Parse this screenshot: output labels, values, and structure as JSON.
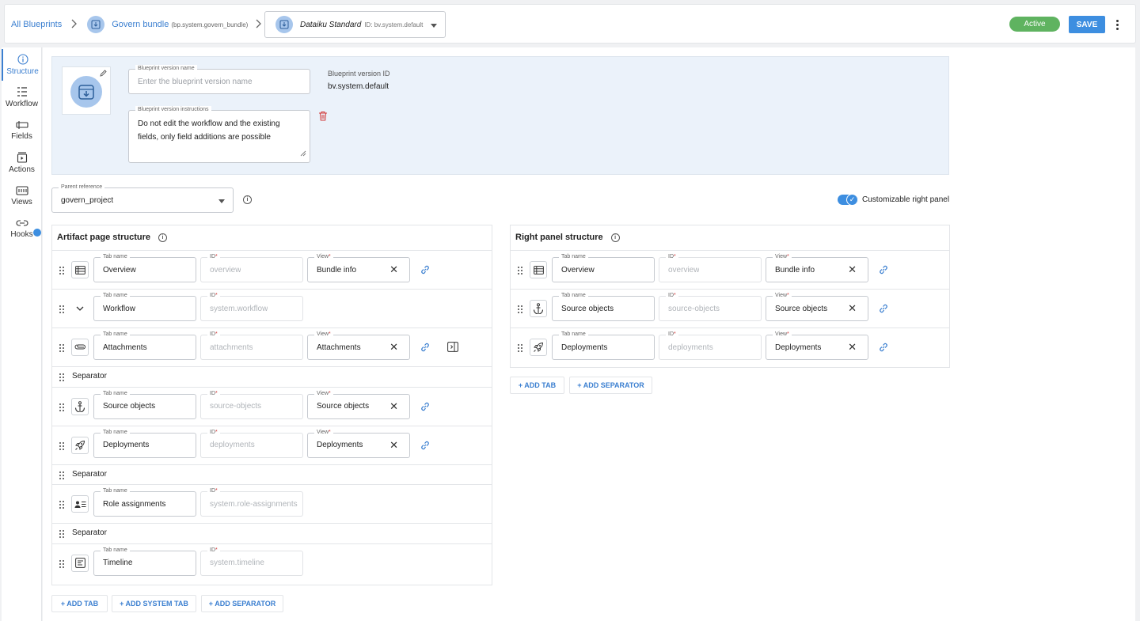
{
  "breadcrumb": {
    "all_blueprints": "All Blueprints",
    "bundle_name": "Govern bundle",
    "bundle_id": "(bp.system.govern_bundle)",
    "version_name": "Dataiku Standard",
    "version_id": "ID: bv.system.default"
  },
  "topbar": {
    "status": "Active",
    "save_label": "SAVE"
  },
  "rail": [
    {
      "label": "Structure"
    },
    {
      "label": "Workflow"
    },
    {
      "label": "Fields"
    },
    {
      "label": "Actions"
    },
    {
      "label": "Views"
    },
    {
      "label": "Hooks"
    }
  ],
  "header": {
    "name_label": "Blueprint version name",
    "name_placeholder": "Enter the blueprint version name",
    "instructions_label": "Blueprint version instructions",
    "instructions_value": "Do not edit the workflow and the existing fields, only field additions are possible",
    "id_label": "Blueprint version ID",
    "id_value": "bv.system.default"
  },
  "parent_reference": {
    "label": "Parent reference",
    "value": "govern_project"
  },
  "customizable_right_panel": {
    "label": "Customizable right panel",
    "enabled": true
  },
  "labels": {
    "tab_name": "Tab name",
    "id": "ID",
    "view": "View",
    "required_mark": "*"
  },
  "artifact_structure": {
    "title": "Artifact page structure",
    "rows": [
      {
        "kind": "tab",
        "icon": "table-icon",
        "tab_name": "Overview",
        "id": "overview",
        "view": "Bundle info"
      },
      {
        "kind": "tab",
        "icon": "chevron-down-icon",
        "tab_name": "Workflow",
        "id": "system.workflow"
      },
      {
        "kind": "tab",
        "icon": "paperclip-icon",
        "tab_name": "Attachments",
        "id": "attachments",
        "view": "Attachments"
      },
      {
        "kind": "separator",
        "label": "Separator"
      },
      {
        "kind": "tab",
        "icon": "anchor-icon",
        "tab_name": "Source objects",
        "id": "source-objects",
        "view": "Source objects"
      },
      {
        "kind": "tab",
        "icon": "rocket-icon",
        "tab_name": "Deployments",
        "id": "deployments",
        "view": "Deployments"
      },
      {
        "kind": "separator",
        "label": "Separator"
      },
      {
        "kind": "tab",
        "icon": "role-assignment-icon",
        "tab_name": "Role assignments",
        "id": "system.role-assignments"
      },
      {
        "kind": "separator",
        "label": "Separator"
      },
      {
        "kind": "tab",
        "icon": "timeline-icon",
        "tab_name": "Timeline",
        "id": "system.timeline"
      }
    ],
    "add_tab": "+ ADD TAB",
    "add_system_tab": "+ ADD SYSTEM TAB",
    "add_separator": "+ ADD SEPARATOR"
  },
  "right_panel_structure": {
    "title": "Right panel structure",
    "rows": [
      {
        "icon": "table-icon",
        "tab_name": "Overview",
        "id": "overview",
        "view": "Bundle info"
      },
      {
        "icon": "anchor-icon",
        "tab_name": "Source objects",
        "id": "source-objects",
        "view": "Source objects"
      },
      {
        "icon": "rocket-icon",
        "tab_name": "Deployments",
        "id": "deployments",
        "view": "Deployments"
      }
    ],
    "add_tab": "+ ADD TAB",
    "add_separator": "+ ADD SEPARATOR"
  },
  "colors": {
    "accent": "#3d8ee0",
    "link": "#3b7fd0",
    "active": "#5fb360",
    "header_bg": "#ebf2fa",
    "danger": "#d23b3b"
  }
}
